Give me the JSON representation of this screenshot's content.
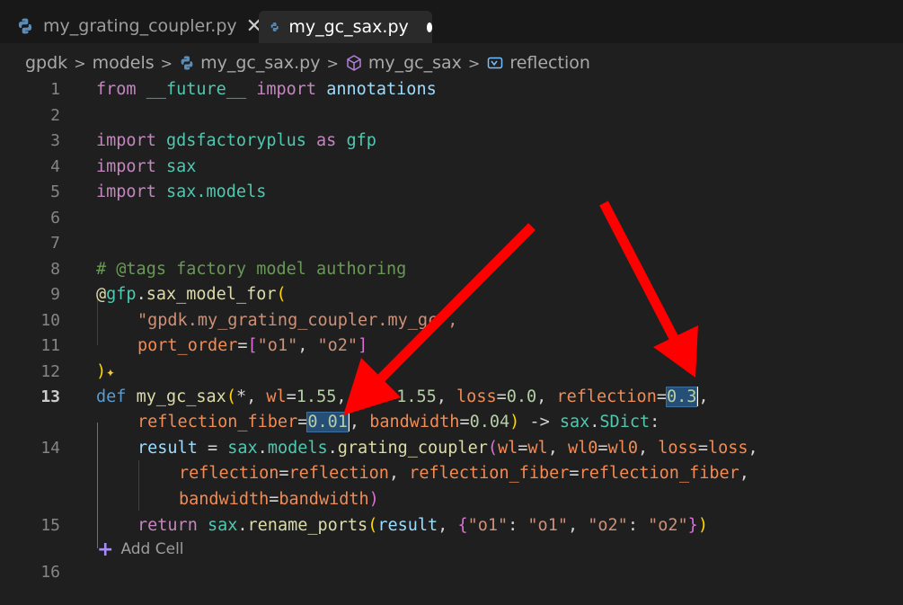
{
  "tabs": [
    {
      "label": "my_grating_coupler.py",
      "icon": "python-icon",
      "close": "✕"
    },
    {
      "label": "my_gc_sax.py",
      "icon": "python-icon",
      "modified": true
    }
  ],
  "breadcrumb": {
    "items": [
      "gpdk",
      "models",
      "my_gc_sax.py",
      "my_gc_sax",
      "reflection"
    ],
    "separator": ">"
  },
  "editor": {
    "line_numbers": [
      "1",
      "2",
      "3",
      "4",
      "5",
      "6",
      "7",
      "8",
      "9",
      "10",
      "11",
      "12",
      "13",
      "14",
      "15",
      "16"
    ],
    "active_line": "13",
    "add_cell_label": "Add Cell"
  },
  "code": {
    "l1": [
      "from",
      " ",
      "__future__",
      " ",
      "import",
      " ",
      "annotations"
    ],
    "l3": [
      "import",
      " ",
      "gdsfactoryplus",
      " ",
      "as",
      " ",
      "gfp"
    ],
    "l4": [
      "import",
      " ",
      "sax"
    ],
    "l5": [
      "import",
      " ",
      "sax.models"
    ],
    "l8": "# @tags factory model authoring",
    "l9": [
      "@",
      "gfp",
      ".",
      "sax_model_for",
      "("
    ],
    "l10": "\"gpdk.my_grating_coupler.my_gc\",",
    "l11": [
      "port_order",
      "=",
      "[",
      "\"o1\"",
      ", ",
      "\"o2\"",
      "]"
    ],
    "l12": [
      ")"
    ],
    "l13": [
      "def",
      " ",
      "my_gc_sax",
      "(",
      "*, ",
      "wl",
      "=",
      "1.55",
      ", ",
      "wl0",
      "=",
      "1.55",
      ", ",
      "loss",
      "=",
      "0.0",
      ", ",
      "reflection",
      "=",
      "0.3",
      ","
    ],
    "l13b": [
      "reflection_fiber",
      "=",
      "0.01",
      ", ",
      "bandwidth",
      "=",
      "0.04",
      ")",
      " -> ",
      "sax",
      ".",
      "SDict",
      ":"
    ],
    "l14": [
      "result",
      " = ",
      "sax",
      ".",
      "models",
      ".",
      "grating_coupler",
      "(",
      "wl",
      "=",
      "wl",
      ", ",
      "wl0",
      "=",
      "wl0",
      ", ",
      "loss",
      "=",
      "loss",
      ","
    ],
    "l14b": [
      "reflection",
      "=",
      "reflection",
      ", ",
      "reflection_fiber",
      "=",
      "reflection_fiber",
      ","
    ],
    "l14c": [
      "bandwidth",
      "=",
      "bandwidth",
      ")"
    ],
    "l15": [
      "return",
      " ",
      "sax",
      ".",
      "rename_ports",
      "(",
      "result",
      ", ",
      "{",
      "\"o1\"",
      ": ",
      "\"o1\"",
      ", ",
      "\"o2\"",
      ": ",
      "\"o2\"",
      "}",
      ")"
    ]
  },
  "colors": {
    "background": "#1f1f1f",
    "keyword": "#c586c0",
    "function": "#dcdcaa",
    "string": "#ce9178",
    "number": "#b5cea8",
    "annotation_arrow": "#ff0000"
  }
}
